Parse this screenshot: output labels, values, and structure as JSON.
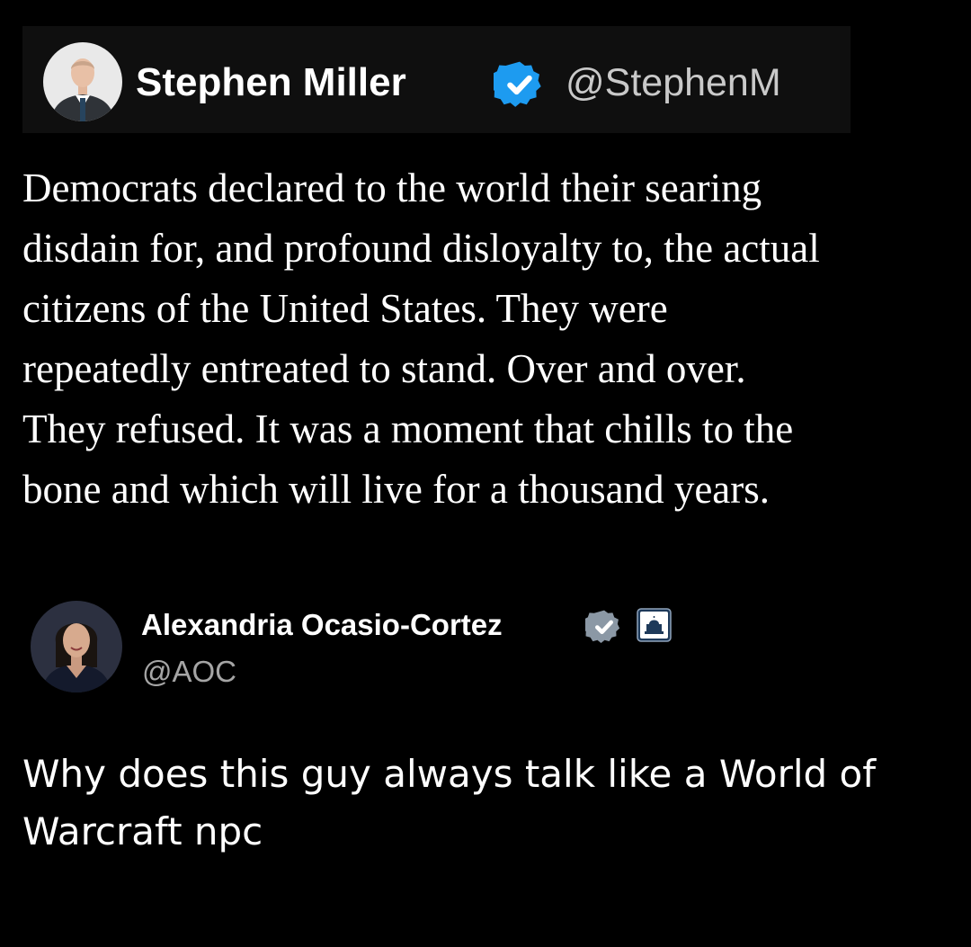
{
  "quoted_post": {
    "author": {
      "name": "Stephen Miller",
      "handle": "@StephenM",
      "verified": true,
      "verified_badge_icon": "blue-check-badge-icon",
      "avatar_icon": "profile-photo-man-in-suit"
    },
    "body_lines": [
      "Democrats declared to the world their searing",
      "disdain for, and profound disloyalty to, the actual",
      "citizens of the United States. They were",
      "repeatedly entreated to stand. Over and over.",
      "They refused. It was a moment that chills to the",
      "bone and which will live for a thousand years."
    ]
  },
  "reply_post": {
    "author": {
      "name": "Alexandria Ocasio-Cortez",
      "handle": "@AOC",
      "verified": true,
      "verified_badge_icon": "grey-check-badge-icon",
      "affiliation_badge_icon": "capitol-building-icon",
      "avatar_icon": "profile-photo-woman"
    },
    "body_lines": [
      "Why does this guy always talk like a World of",
      "Warcraft npc"
    ]
  },
  "colors": {
    "background": "#000000",
    "header_background": "#0f0f0f",
    "verified_blue": "#1d9bf0",
    "verified_grey": "#8b98a5",
    "text_primary": "#ffffff",
    "handle_text": "#c9c9c9"
  }
}
